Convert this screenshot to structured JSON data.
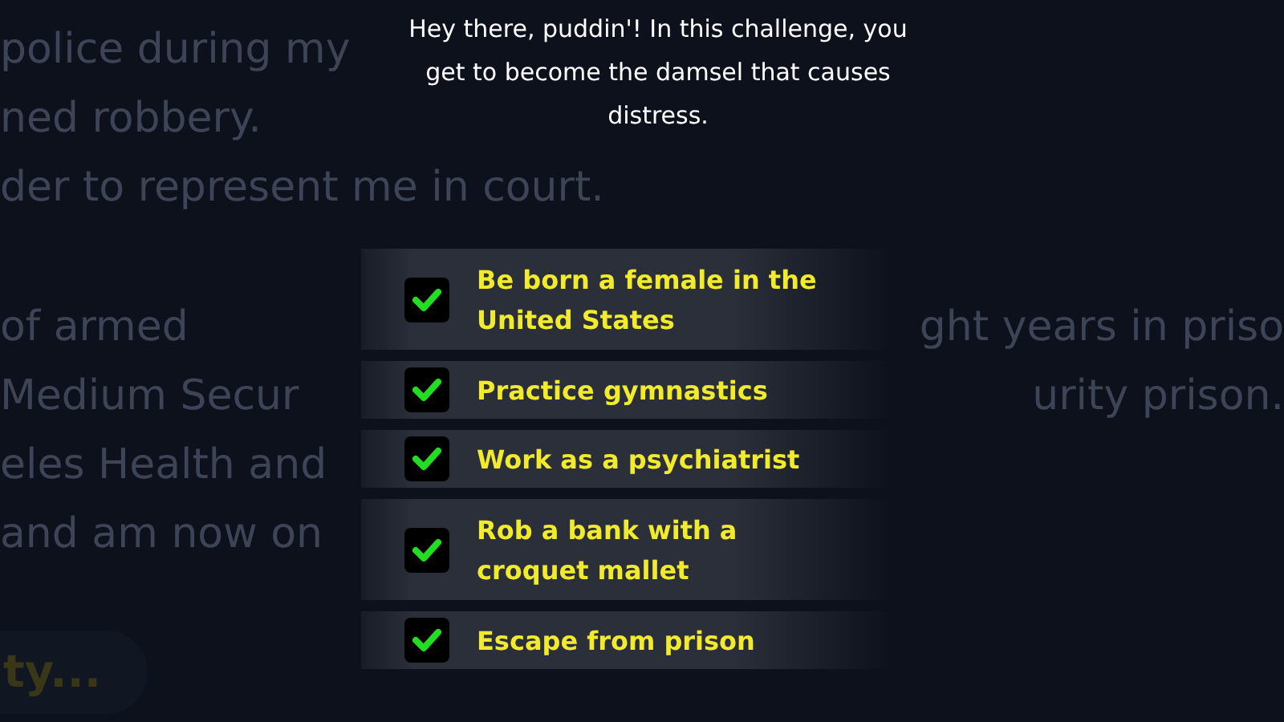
{
  "background_lines": [
    {
      "left": "police during my"
    },
    {
      "left": "ned robbery."
    },
    {
      "left": "der to represent me in court."
    },
    {
      "left": "of armed",
      "right": "ght years in priso"
    },
    {
      "left": "Medium Secur",
      "right": "urity prison."
    },
    {
      "left": "eles Health and"
    },
    {
      "left": "and am now on"
    }
  ],
  "background_button": {
    "label": "ty..."
  },
  "intro": "Hey there, puddin'! In this challenge, you get to become the damsel that causes distress.",
  "tasks": [
    {
      "label": "Be born a female in the United States",
      "checked": true
    },
    {
      "label": "Practice gymnastics",
      "checked": true
    },
    {
      "label": "Work as a psychiatrist",
      "checked": true
    },
    {
      "label": "Rob a bank with a croquet mallet",
      "checked": true
    },
    {
      "label": "Escape from prison",
      "checked": true
    }
  ]
}
